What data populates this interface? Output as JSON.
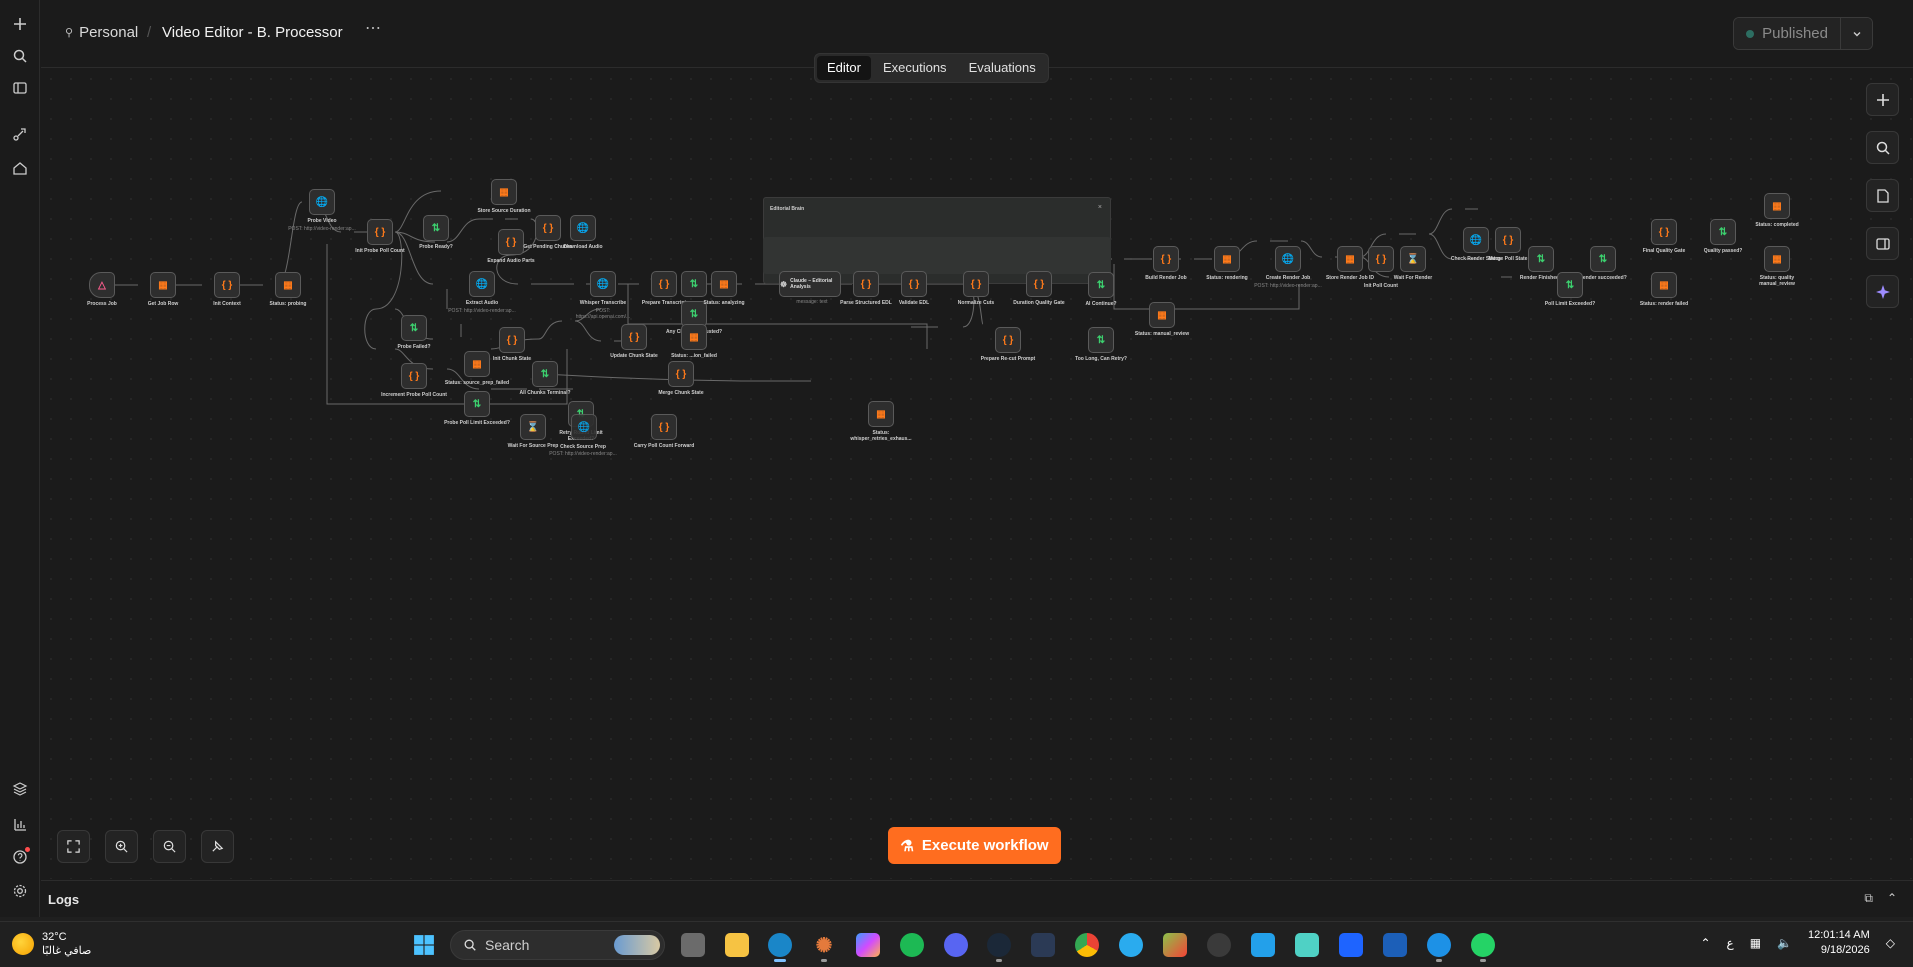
{
  "header": {
    "workspace": "Personal",
    "workflow_title": "Video Editor - B. Processor",
    "more": "⋯",
    "tabs": [
      "Editor",
      "Executions",
      "Evaluations"
    ],
    "publish_label": "Published"
  },
  "nodes": {
    "process_job": "Process Job",
    "get_job_row": "Get Job Row",
    "init_context": "Init Context",
    "status_probing": "Status: probing",
    "probe_video": "Probe Video",
    "probe_video_sub": "POST: http://video-render:ap...",
    "init_probe_poll": "Init Probe Poll Count",
    "probe_ready": "Probe Ready?",
    "store_source_duration": "Store Source Duration",
    "expand_audio_parts": "Expand Audio Parts",
    "get_pending_chunks": "Get Pending Chunks",
    "download_audio": "Download Audio",
    "extract_audio": "Extract Audio",
    "extract_audio_sub": "POST: http://video-render:ap...",
    "probe_failed": "Probe Failed?",
    "init_chunk_state": "Init Chunk State",
    "increment_probe_poll": "Increment Probe Poll Count",
    "status_source_prep_failed": "Status: source_prep_failed",
    "all_chunks_terminal": "All Chunks Terminal?",
    "probe_poll_limit": "Probe Poll Limit Exceeded?",
    "wait_source_prep": "Wait For Source Prep",
    "retry_round_limit": "Retry Round Limit Exceeded?",
    "check_source_prep": "Check Source Prep",
    "check_source_prep_sub": "POST: http://video-render:ap...",
    "carry_poll_count": "Carry Poll Count Forward",
    "whisper_transcribe": "Whisper Transcribe",
    "whisper_sub": "POST: https://api.openai.com/...",
    "prepare_transcript": "Prepare Transcript",
    "update_chunk_state": "Update Chunk State",
    "any_chunk_exhausted": "Any Chunk Exhausted?",
    "status_analyzing": "Status: analyzing",
    "status_failed": "Status: ...ion_failed",
    "merge_chunk_state": "Merge Chunk State",
    "status_whisper_failed": "Status: whisper_retries_exhaus...",
    "group_title": "Editorial Brain",
    "claude_analysis": "Claude – Editorial Analysis",
    "claude_sub": "message: text",
    "parse_edl": "Parse Structured EDL",
    "validate_edl": "Validate EDL",
    "normalize_cuts": "Normalize Cuts",
    "duration_quality_gate": "Duration Quality Gate",
    "prepare_reprompt": "Prepare Re-cut Prompt",
    "ai_continue": "AI Continue?",
    "too_long": "Too Long, Can Retry?",
    "status_manual_review": "Status: manual_review",
    "build_render_job": "Build Render Job",
    "status_rendering": "Status: rendering",
    "create_render_job": "Create Render Job",
    "create_render_sub": "POST: http://video-render:ap...",
    "store_render_job": "Store Render Job ID",
    "init_poll_count": "Init Poll Count",
    "wait_for_render": "Wait For Render",
    "check_render_status": "Check Render Status",
    "merge_poll_state": "Merge Poll State",
    "render_finished": "Render Finished?",
    "render_succeeded": "Render succeeded?",
    "poll_limit_exceeded": "Poll Limit Exceeded?",
    "final_quality_gate": "Final Quality Gate",
    "quality_passed": "Quality passed?",
    "status_completed": "Status: completed",
    "status_quality_manual": "Status: quality manual_review",
    "status_render_failed": "Status: render failed"
  },
  "execute_label": "Execute workflow",
  "logs_label": "Logs",
  "taskbar": {
    "temp": "32°C",
    "weather_desc": "صافي غالبًا",
    "search": "Search",
    "lang": "ع",
    "time": "12:01:14 AM",
    "date": "9/18/2026"
  },
  "colors": {
    "accent": "#ff6d1f",
    "set_node": "#ff7a1a",
    "if_node": "#3ccf6e",
    "http_node": "#8fa3ff",
    "wait_node": "#ff5d8f"
  }
}
